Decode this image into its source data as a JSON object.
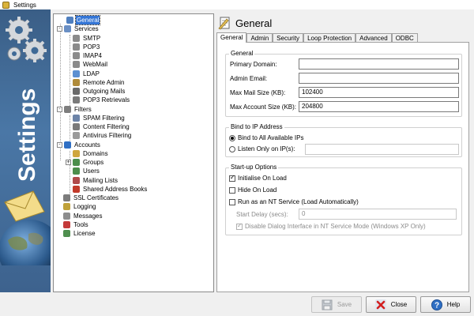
{
  "window": {
    "title": "Settings"
  },
  "banner": {
    "text": "Settings"
  },
  "tree": {
    "items": [
      {
        "label": "General",
        "icon": "general-icon",
        "selected": true
      },
      {
        "label": "Services",
        "icon": "services-icon"
      },
      {
        "label": "SMTP",
        "icon": "smtp-icon"
      },
      {
        "label": "POP3",
        "icon": "pop3-icon"
      },
      {
        "label": "IMAP4",
        "icon": "imap4-icon"
      },
      {
        "label": "WebMail",
        "icon": "webmail-icon"
      },
      {
        "label": "LDAP",
        "icon": "ldap-icon"
      },
      {
        "label": "Remote Admin",
        "icon": "remote-admin-icon"
      },
      {
        "label": "Outgoing Mails",
        "icon": "outgoing-mails-icon"
      },
      {
        "label": "POP3 Retrievals",
        "icon": "pop3-retrievals-icon"
      },
      {
        "label": "Filters",
        "icon": "filters-icon"
      },
      {
        "label": "SPAM Filtering",
        "icon": "spam-filtering-icon"
      },
      {
        "label": "Content Filtering",
        "icon": "content-filtering-icon"
      },
      {
        "label": "Antivirus Filtering",
        "icon": "antivirus-filtering-icon"
      },
      {
        "label": "Accounts",
        "icon": "accounts-icon"
      },
      {
        "label": "Domains",
        "icon": "domains-icon"
      },
      {
        "label": "Groups",
        "icon": "groups-icon"
      },
      {
        "label": "Users",
        "icon": "users-icon"
      },
      {
        "label": "Mailing Lists",
        "icon": "mailing-lists-icon"
      },
      {
        "label": "Shared Address Books",
        "icon": "shared-address-books-icon"
      },
      {
        "label": "SSL Certificates",
        "icon": "ssl-certificates-icon"
      },
      {
        "label": "Logging",
        "icon": "logging-icon"
      },
      {
        "label": "Messages",
        "icon": "messages-icon"
      },
      {
        "label": "Tools",
        "icon": "tools-icon"
      },
      {
        "label": "License",
        "icon": "license-icon"
      }
    ]
  },
  "pane": {
    "title": "General",
    "tabs": [
      "General",
      "Admin",
      "Security",
      "Loop Protection",
      "Advanced",
      "ODBC"
    ],
    "general_group": {
      "label": "General",
      "primary_domain": {
        "label": "Primary Domain:",
        "value": ""
      },
      "admin_email": {
        "label": "Admin Email:",
        "value": ""
      },
      "max_mail_size": {
        "label": "Max Mail Size (KB):",
        "value": "102400"
      },
      "max_account_size": {
        "label": "Max Account Size (KB):",
        "value": "204800"
      }
    },
    "bind_group": {
      "label": "Bind to IP Address",
      "bind_all": {
        "label": "Bind to All Available IPs",
        "checked": true
      },
      "listen_only": {
        "label": "Listen Only on IP(s):",
        "checked": false,
        "value": ""
      }
    },
    "startup_group": {
      "label": "Start-up Options",
      "initialise_on_load": {
        "label": "Initialise On Load",
        "checked": true
      },
      "hide_on_load": {
        "label": "Hide On Load",
        "checked": false
      },
      "run_as_service": {
        "label": "Run as an NT Service (Load Automatically)",
        "checked": false
      },
      "start_delay": {
        "label": "Start Delay (secs):",
        "value": "0"
      },
      "disable_dialog": {
        "label": "Disable Dialog Interface in NT Service Mode (Windows XP Only)",
        "checked": true
      }
    }
  },
  "buttons": {
    "save": "Save",
    "close": "Close",
    "help": "Help"
  },
  "colors": {
    "selection": "#3375d6",
    "banner": "#3b5f8a"
  }
}
